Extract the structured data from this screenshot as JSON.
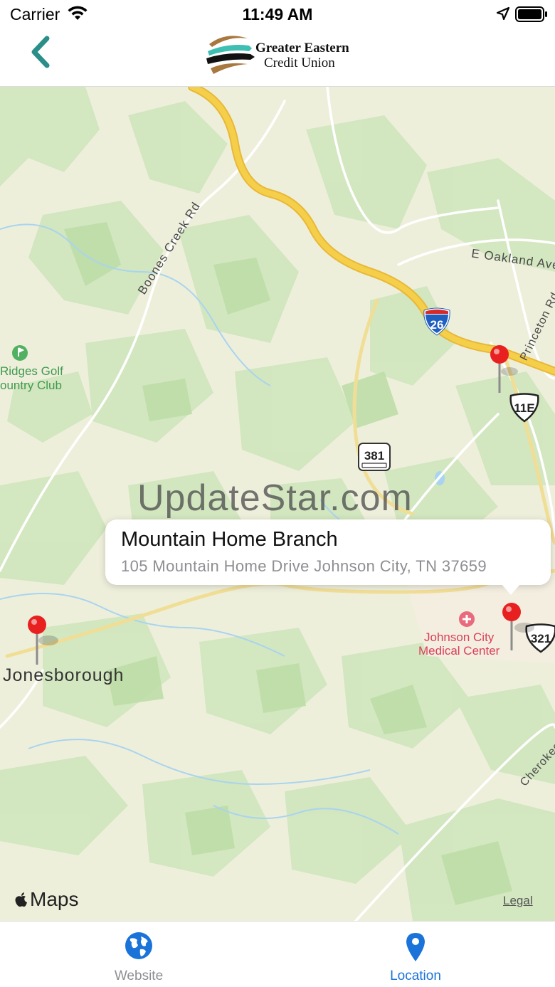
{
  "status_bar": {
    "carrier": "Carrier",
    "time": "11:49 AM"
  },
  "nav": {
    "brand_line1": "Greater Eastern",
    "brand_line2": "Credit Union",
    "back_icon": "chevron-left-icon",
    "accent_color": "#2a8f88"
  },
  "map": {
    "labels": {
      "boones_creek_rd": "Boones Creek Rd",
      "e_oakland_ave": "E Oakland Ave",
      "princeton_rd": "Princeton Rd",
      "golf_club": "Ridges Golf\nountry Club",
      "jonesborough": "Jonesborough",
      "medical_center": "Johnson City\nMedical Center",
      "cherokee": "Cherokee"
    },
    "shields": {
      "interstate": "26",
      "state_route": "381",
      "us_route_11e": "11E",
      "us_route_321": "321"
    },
    "watermark": "UpdateStar.com",
    "attribution": "Maps",
    "legal": "Legal",
    "pin_color": "#e8201f"
  },
  "callout": {
    "title": "Mountain Home Branch",
    "address": "105 Mountain Home Drive Johnson City, TN  37659"
  },
  "tabs": [
    {
      "label": "Website",
      "icon": "globe-icon",
      "active": false
    },
    {
      "label": "Location",
      "icon": "map-pin-icon",
      "active": true
    }
  ],
  "colors": {
    "tab_active": "#1a73d9",
    "tab_inactive": "#8e8e93",
    "interstate_blue": "#1f5fbf",
    "highway_yellow": "#f6cf4a"
  }
}
